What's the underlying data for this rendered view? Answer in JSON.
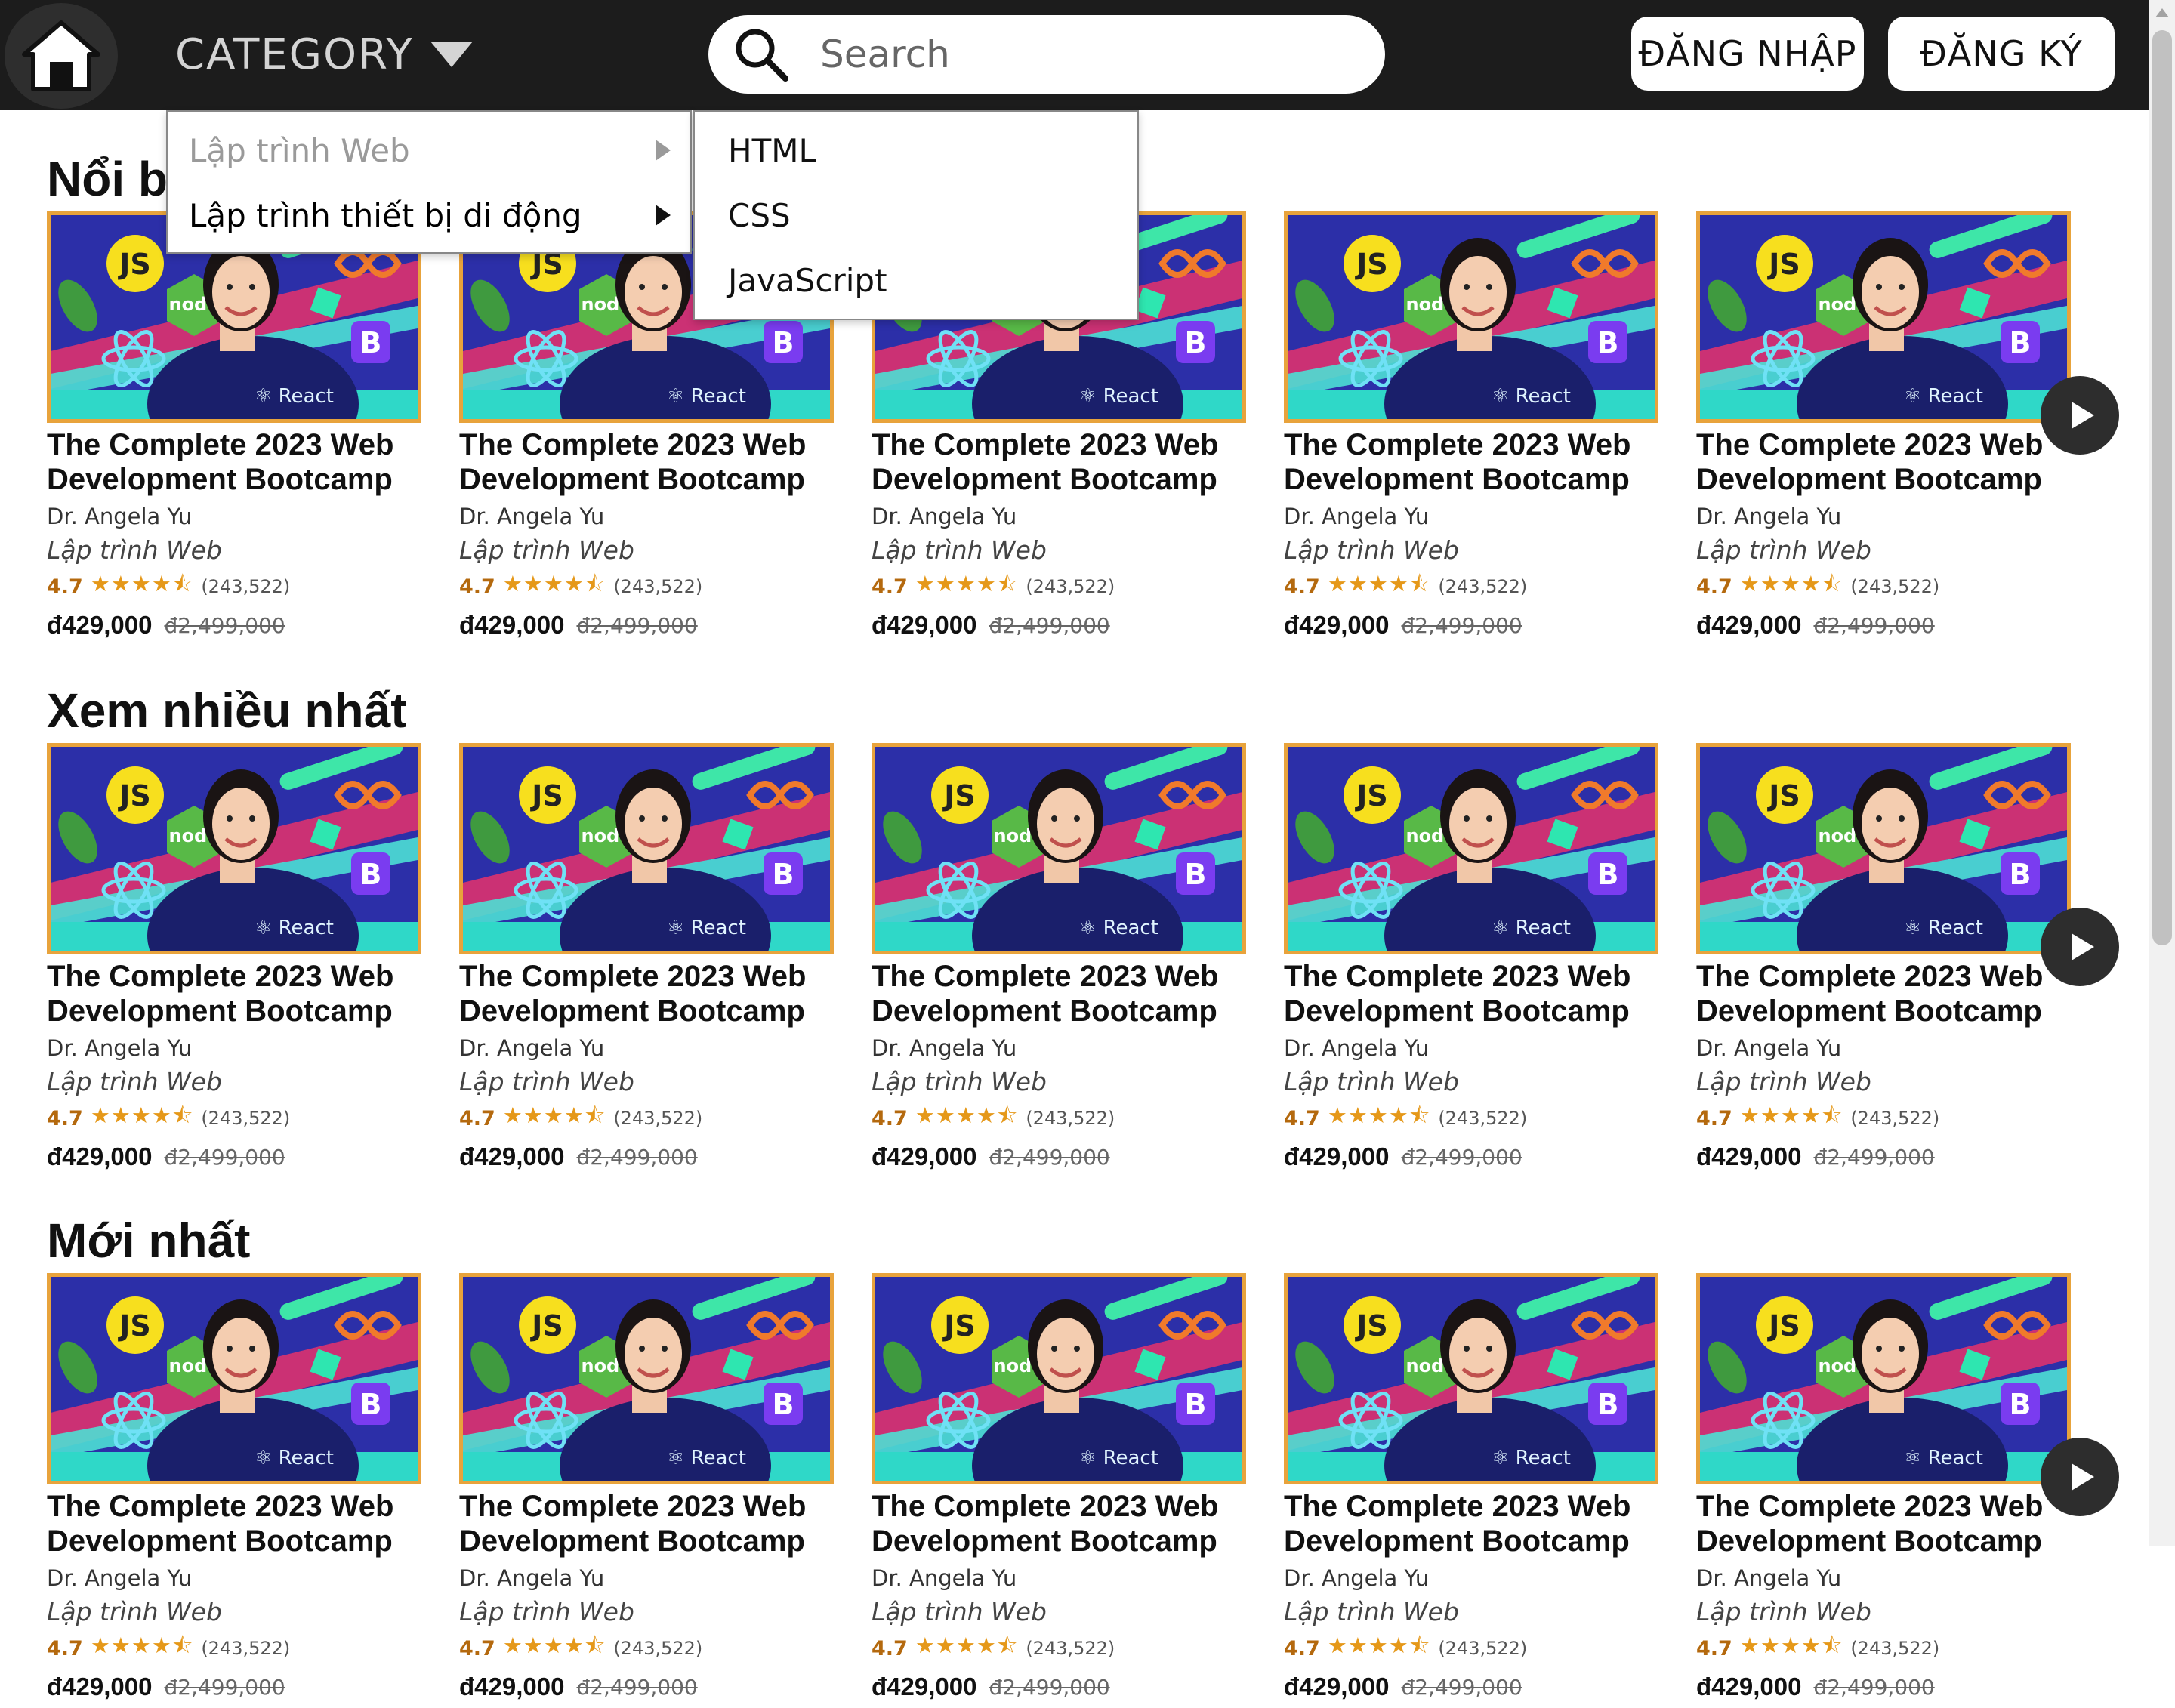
{
  "header": {
    "category_label": "CATEGORY",
    "search_placeholder": "Search",
    "login_label": "ĐĂNG NHẬP",
    "register_label": "ĐĂNG KÝ"
  },
  "category_menu": {
    "items": [
      {
        "label": "Lập trình Web"
      },
      {
        "label": "Lập trình thiết bị di động"
      }
    ],
    "submenu": [
      {
        "label": "HTML"
      },
      {
        "label": "CSS"
      },
      {
        "label": "JavaScript"
      }
    ]
  },
  "sections": [
    {
      "title": "Nổi bật"
    },
    {
      "title": "Xem nhiều nhất"
    },
    {
      "title": "Mới nhất"
    }
  ],
  "course": {
    "title_line1": "The Complete 2023 Web",
    "title_line2": "Development Bootcamp",
    "author": "Dr. Angela Yu",
    "category": "Lập trình Web",
    "rating": "4.7",
    "stars": "★★★★⯪",
    "reviews": "(243,522)",
    "price": "đ429,000",
    "old_price": "đ2,499,000"
  },
  "colors": {
    "topbar": "#1c1c1c",
    "thumb_border": "#e8a33c",
    "star": "#e59819",
    "rating_text": "#b4690e"
  }
}
